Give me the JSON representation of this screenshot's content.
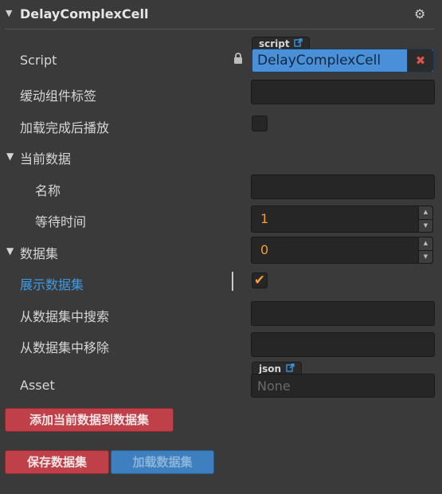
{
  "component": {
    "title": "DelayComplexCell",
    "arrow": "▼",
    "gear": "⚙"
  },
  "script": {
    "label": "Script",
    "tag": "script",
    "value": "DelayComplexCell",
    "lock": "🔒",
    "clear": "✖"
  },
  "props": {
    "tween_tag_label": "缓动组件标签",
    "tween_tag_value": "",
    "autoplay_label": "加载完成后播放",
    "current_data_label": "当前数据",
    "name_label": "名称",
    "name_value": "",
    "wait_label": "等待时间",
    "wait_value": "1",
    "dataset_label": "数据集",
    "dataset_value": "0",
    "show_dataset_label": "展示数据集",
    "search_label": "从数据集中搜索",
    "search_value": "",
    "remove_label": "从数据集中移除",
    "remove_value": "",
    "asset_label": "Asset",
    "asset_tag": "json",
    "asset_value": "None"
  },
  "buttons": {
    "add": "添加当前数据到数据集",
    "save": "保存数据集",
    "load": "加载数据集"
  },
  "icons": {
    "external": "⧉",
    "check": "✔",
    "up": "▲",
    "down": "▼"
  },
  "colors": {
    "accent_orange": "#f39c37",
    "accent_blue": "#3c9be6",
    "script_field": "#4a90d9",
    "danger_red": "#c0404a"
  }
}
